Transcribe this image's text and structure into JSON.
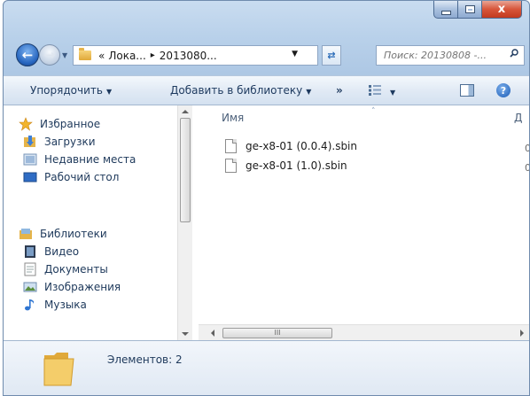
{
  "window": {
    "controls": {
      "minimize": "",
      "maximize": "",
      "close": "x"
    }
  },
  "address": {
    "overflow": "«",
    "crumbs": [
      "Лока...",
      "2013080..."
    ],
    "separator": "▸"
  },
  "search": {
    "placeholder": "Поиск: 20130808 -..."
  },
  "toolbar": {
    "organize": "Упорядочить",
    "add_to_library": "Добавить в библиотеку",
    "more": "»"
  },
  "nav": {
    "favorites": "Избранное",
    "downloads": "Загрузки",
    "recent": "Недавние места",
    "desktop": "Рабочий стол",
    "libraries": "Библиотеки",
    "video": "Видео",
    "documents": "Документы",
    "images": "Изображения",
    "music": "Музыка"
  },
  "content": {
    "col_name": "Имя",
    "col_next": "Д",
    "files": [
      {
        "name": "ge-x8-01 (0.0.4).sbin",
        "date": "0"
      },
      {
        "name": "ge-x8-01 (1.0).sbin",
        "date": "0"
      }
    ],
    "hscroll_grip": "III"
  },
  "status": {
    "items": "Элементов: 2"
  },
  "colors": {
    "accent": "#2766c0",
    "frame": "#b9d1ea",
    "close": "#c23a1f"
  }
}
